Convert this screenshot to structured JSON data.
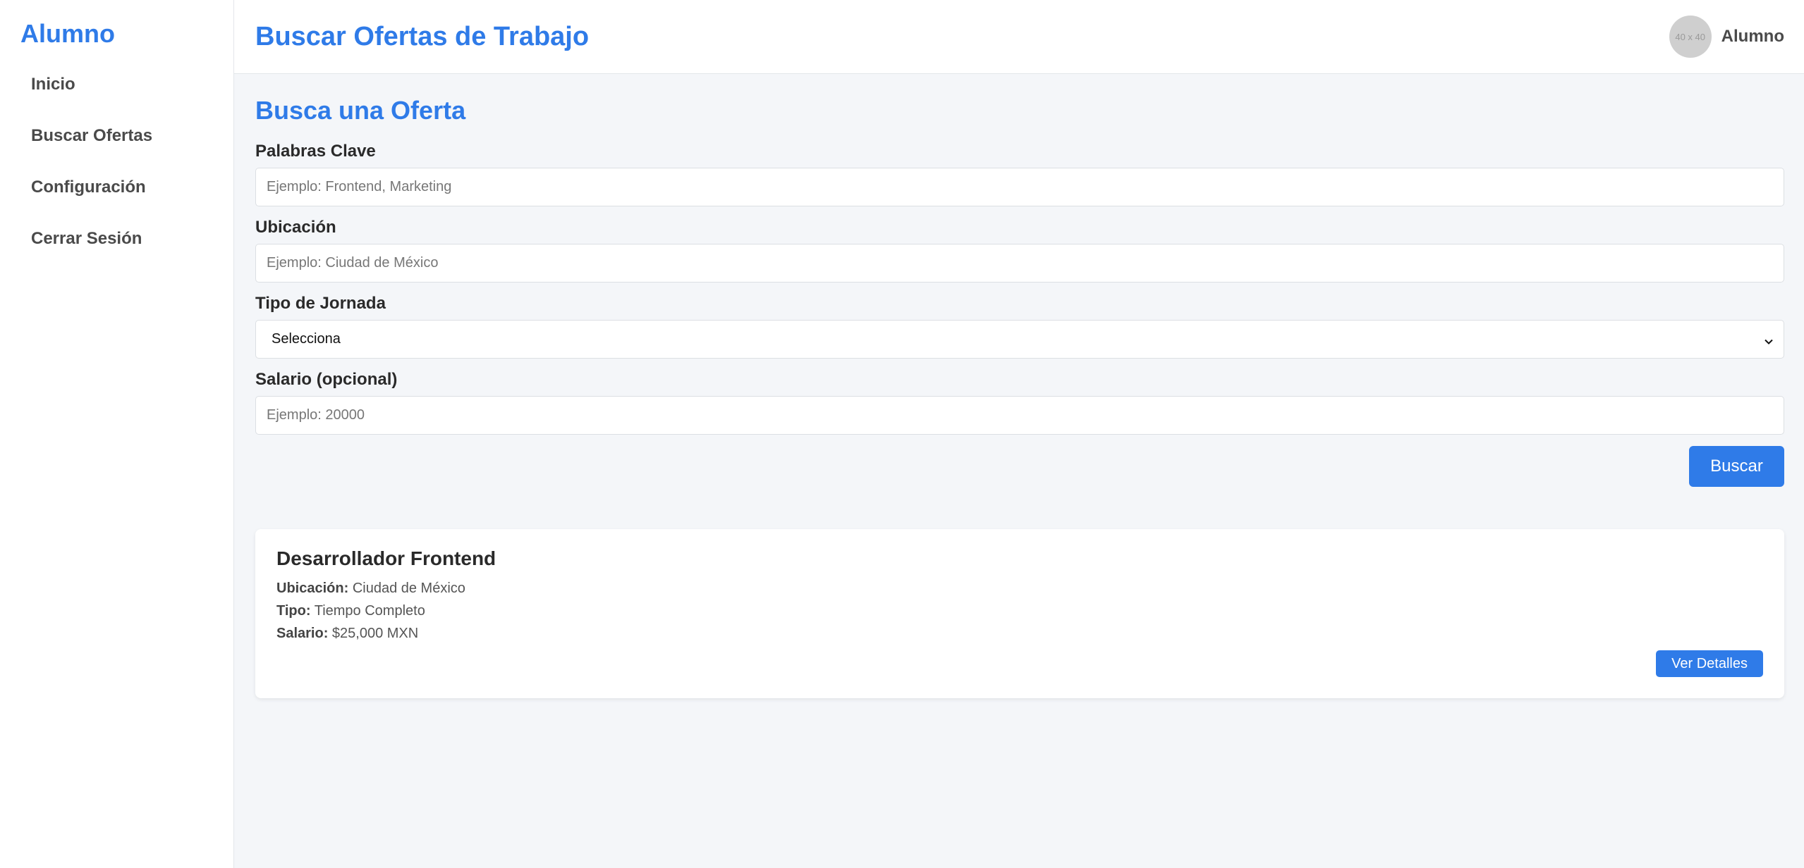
{
  "sidebar": {
    "brand": "Alumno",
    "items": [
      {
        "label": "Inicio"
      },
      {
        "label": "Buscar Ofertas"
      },
      {
        "label": "Configuración"
      },
      {
        "label": "Cerrar Sesión"
      }
    ]
  },
  "header": {
    "title": "Buscar Ofertas de Trabajo",
    "avatar_text": "40 x 40",
    "user_name": "Alumno"
  },
  "search": {
    "section_title": "Busca una Oferta",
    "keywords": {
      "label": "Palabras Clave",
      "placeholder": "Ejemplo: Frontend, Marketing",
      "value": ""
    },
    "location": {
      "label": "Ubicación",
      "placeholder": "Ejemplo: Ciudad de México",
      "value": ""
    },
    "schedule": {
      "label": "Tipo de Jornada",
      "selected": "Selecciona"
    },
    "salary": {
      "label": "Salario (opcional)",
      "placeholder": "Ejemplo: 20000",
      "value": ""
    },
    "submit_label": "Buscar"
  },
  "results": [
    {
      "title": "Desarrollador Frontend",
      "location_label": "Ubicación:",
      "location": "Ciudad de México",
      "type_label": "Tipo:",
      "type": "Tiempo Completo",
      "salary_label": "Salario:",
      "salary": "$25,000 MXN",
      "button_label": "Ver Detalles"
    }
  ],
  "colors": {
    "accent": "#2f7be8",
    "background": "#f4f6f9",
    "surface": "#ffffff"
  }
}
